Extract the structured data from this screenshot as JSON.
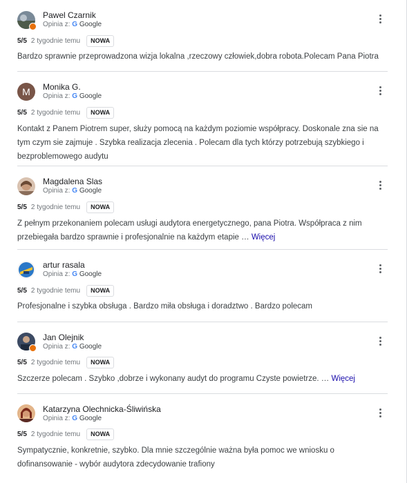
{
  "source_label": "Opinia z:",
  "google_label": "Google",
  "new_label": "NOWA",
  "reviews": [
    {
      "author": "Pawel Czarnik",
      "rating": "5/5",
      "time": "2 tygodnie temu",
      "text": "Bardzo sprawnie przeprowadzona wizja lokalna ,rzeczowy człowiek,dobra robota.Polecam Pana Piotra",
      "more": ""
    },
    {
      "author": "Monika G.",
      "avatar_letter": "M",
      "rating": "5/5",
      "time": "2 tygodnie temu",
      "text": "Kontakt z Panem Piotrem super, służy pomocą na każdym poziomie współpracy. Doskonale zna sie na tym czym sie zajmuje . Szybka realizacja zlecenia . Polecam dla tych którzy potrzebują szybkiego i bezproblemowego audytu",
      "more": ""
    },
    {
      "author": "Magdalena Slas",
      "rating": "5/5",
      "time": "2 tygodnie temu",
      "text": "Z pełnym przekonaniem polecam usługi audytora energetycznego, pana Piotra. Współpraca z nim przebiegała bardzo sprawnie i profesjonalnie na każdym etapie …",
      "more": "Więcej"
    },
    {
      "author": "artur rasala",
      "rating": "5/5",
      "time": "2 tygodnie temu",
      "text": "Profesjonalne i szybka obsługa . Bardzo miła obsługa i doradztwo . Bardzo polecam",
      "more": ""
    },
    {
      "author": "Jan Olejnik",
      "rating": "5/5",
      "time": "2 tygodnie temu",
      "text": "Szczerze polecam . Szybko ,dobrze i wykonany audyt do programu Czyste powietrze. …",
      "more": "Więcej"
    },
    {
      "author": "Katarzyna Olechnicka-Śliwińska",
      "rating": "5/5",
      "time": "2 tygodnie temu",
      "text": "Sympatycznie, konkretnie, szybko. Dla mnie szczególnie ważna była pomoc we wniosku o dofinansowanie - wybór audytora zdecydowanie trafiony",
      "more": ""
    }
  ]
}
